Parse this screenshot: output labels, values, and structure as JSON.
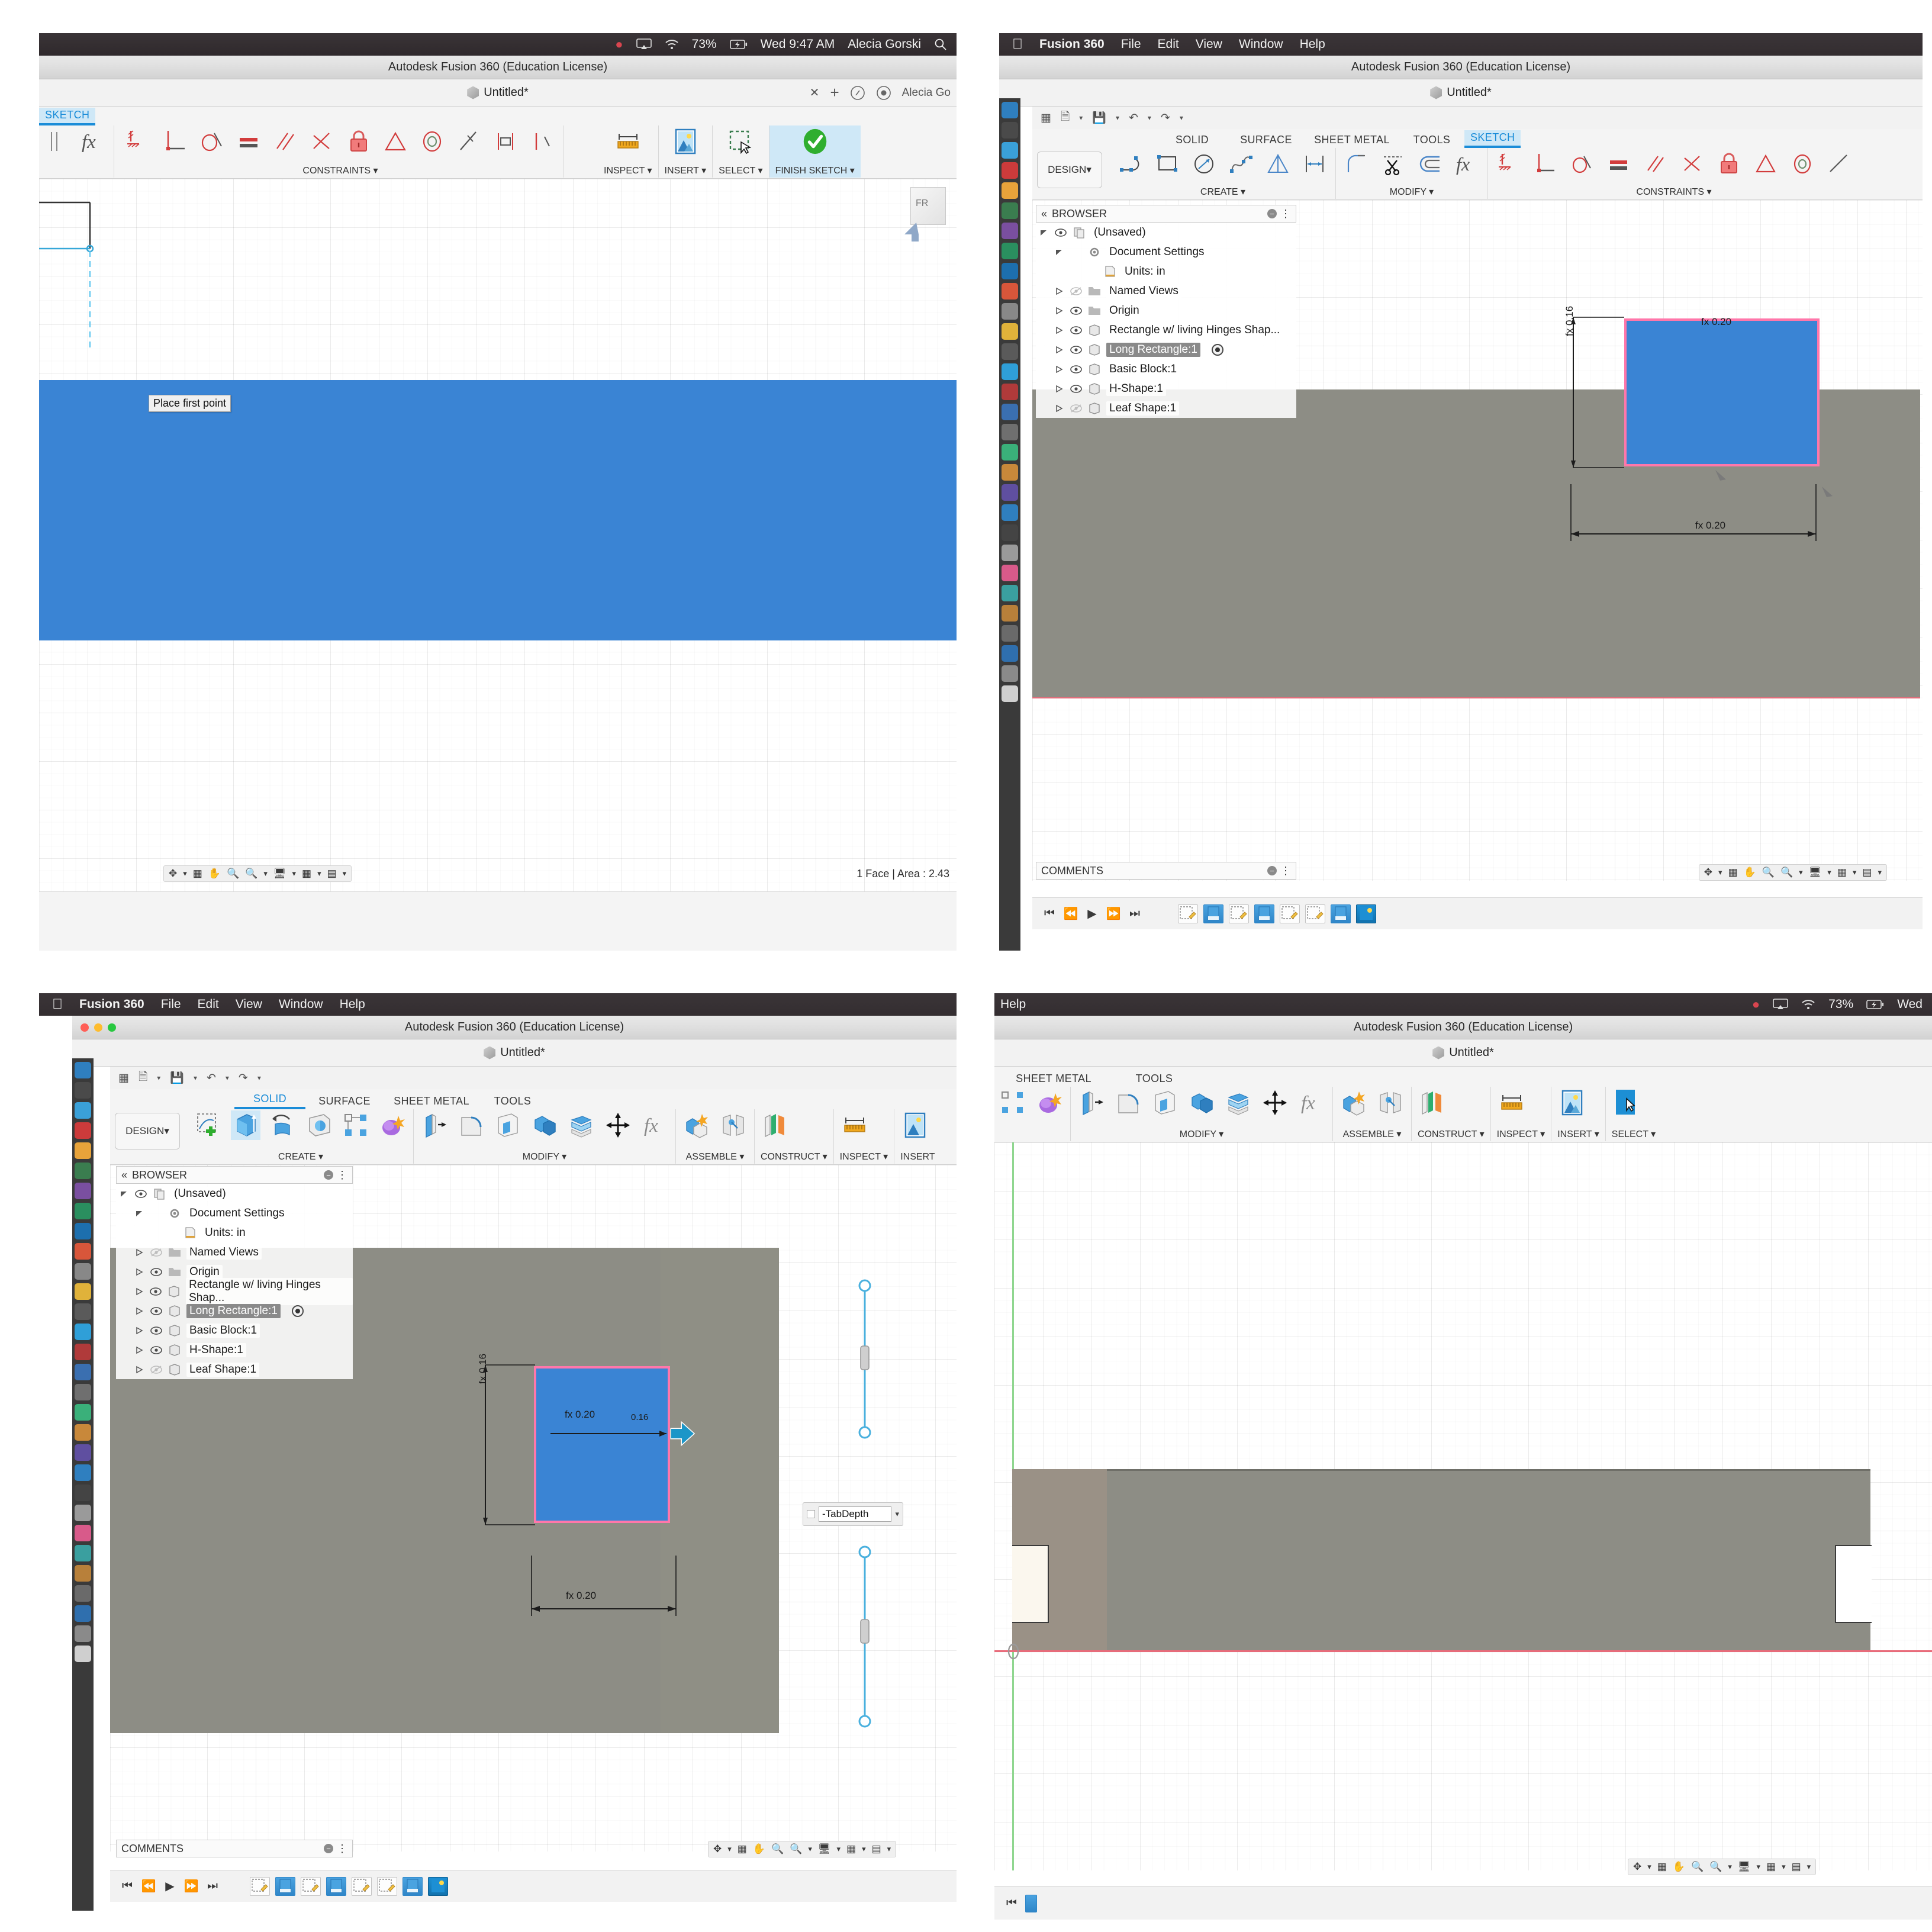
{
  "app": {
    "window_title": "Autodesk Fusion 360 (Education License)",
    "document_tab": "Untitled*",
    "menu": [
      "Fusion 360",
      "File",
      "Edit",
      "View",
      "Window",
      "Help"
    ],
    "apple_glyph": "",
    "help_only": "Help"
  },
  "macbar": {
    "battery": "73%",
    "clock": "Wed 9:47 AM",
    "user": "Alecia Gorski",
    "clock_short": "Wed",
    "icons": [
      "shield-icon",
      "airplay-icon",
      "wifi-icon",
      "battery-icon",
      "search-icon"
    ]
  },
  "ribbon": {
    "workspace": "DESIGN",
    "tabs": [
      "SOLID",
      "SURFACE",
      "SHEET METAL",
      "TOOLS",
      "SKETCH"
    ],
    "panels_solid": [
      "CREATE",
      "MODIFY",
      "ASSEMBLE",
      "CONSTRUCT",
      "INSPECT",
      "INSERT",
      "SELECT"
    ],
    "panels_sketch": [
      "CREATE",
      "MODIFY",
      "CONSTRAINTS",
      "INSPECT",
      "INSERT",
      "SELECT",
      "FINISH SKETCH"
    ],
    "finish_sketch": "FINISH SKETCH",
    "create": "CREATE",
    "modify": "MODIFY",
    "constraints": "CONSTRAINTS",
    "assemble": "ASSEMBLE",
    "construct": "CONSTRUCT",
    "inspect": "INSPECT",
    "insert": "INSERT",
    "select": "SELECT"
  },
  "browser": {
    "title": "BROWSER",
    "items": [
      {
        "label": "(Unsaved)",
        "indent": 0,
        "twist": "down",
        "eye": true,
        "icon": "document-icon",
        "selected": false
      },
      {
        "label": "Document Settings",
        "indent": 1,
        "twist": "down",
        "eye": false,
        "icon": "gear-icon",
        "selected": false
      },
      {
        "label": "Units: in",
        "indent": 2,
        "twist": "none",
        "eye": false,
        "icon": "units-icon",
        "selected": false
      },
      {
        "label": "Named Views",
        "indent": 1,
        "twist": "right",
        "eye": false,
        "icon": "folder-icon",
        "selected": false
      },
      {
        "label": "Origin",
        "indent": 1,
        "twist": "right",
        "eye": true,
        "icon": "folder-icon",
        "selected": false
      },
      {
        "label": "Rectangle w/ living Hinges Shap...",
        "indent": 1,
        "twist": "right",
        "eye": true,
        "icon": "body-icon",
        "selected": false
      },
      {
        "label": "Long Rectangle:1",
        "indent": 1,
        "twist": "right",
        "eye": true,
        "icon": "body-icon",
        "selected": true
      },
      {
        "label": "Basic Block:1",
        "indent": 1,
        "twist": "right",
        "eye": true,
        "icon": "body-icon",
        "selected": false
      },
      {
        "label": "H-Shape:1",
        "indent": 1,
        "twist": "right",
        "eye": true,
        "icon": "body-icon",
        "selected": false
      },
      {
        "label": "Leaf Shape:1",
        "indent": 1,
        "twist": "right",
        "eye": false,
        "icon": "body-icon",
        "selected": false
      }
    ]
  },
  "comments": {
    "title": "COMMENTS"
  },
  "canvas": {
    "tooltip_place_point": "Place first point",
    "status_tl": "1 Face | Area : 2.43",
    "dims": {
      "width_20": "fx  0.20",
      "height_16": "fx  0.16",
      "bottom_20": "fx  0.20",
      "inline_016": "0.16"
    },
    "tabdepth_value": "-TabDepth"
  },
  "navbar": {
    "buttons": [
      "orbit-icon",
      "look-at-icon",
      "pan-icon",
      "zoom-icon",
      "fit-icon",
      "display-settings-icon",
      "grid-settings-icon",
      "viewports-icon"
    ]
  },
  "timeline": {
    "controls": [
      "jump-start-icon",
      "step-back-icon",
      "play-icon",
      "step-forward-icon",
      "jump-end-icon"
    ],
    "feature_count_tr": 8,
    "feature_count_bl": 8
  },
  "colors": {
    "accent_blue": "#1a8cd8",
    "sketch_fill": "#3a84d4",
    "face_grey": "#8d8d85",
    "selection_pink": "#ff77aa",
    "finish_green": "#2fae2f",
    "titlebar": "#e2e2e2"
  }
}
